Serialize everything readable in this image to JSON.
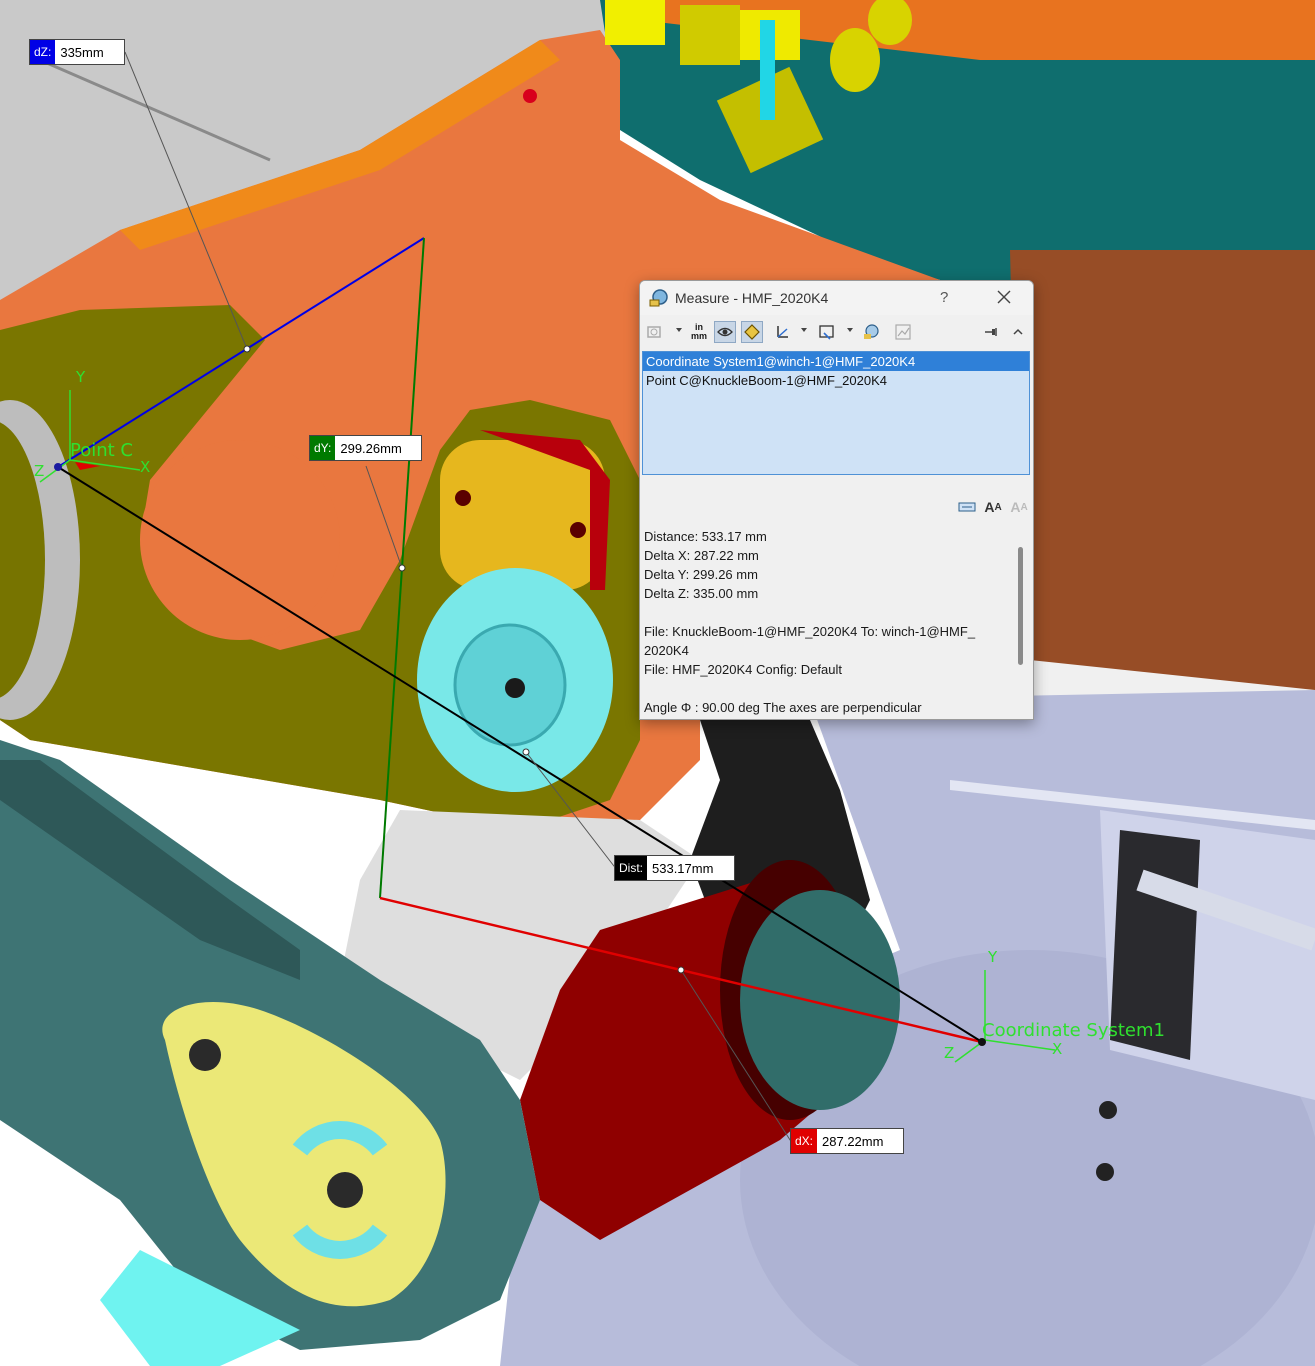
{
  "dialog": {
    "title": "Measure - HMF_2020K4",
    "help_label": "?",
    "toolbar": {
      "icons": [
        "arc-circle-icon",
        "units-precision-icon",
        "show-xyz-icon",
        "point-to-point-icon",
        "projection-icon",
        "select-coordinate-system-icon",
        "create-sensor-icon",
        "measurement-history-icon",
        "pin-icon",
        "collapse-icon"
      ],
      "units_label_top": "in",
      "units_label_bottom": "mm"
    },
    "selections": [
      "Coordinate System1@winch-1@HMF_2020K4",
      "Point C@KnuckleBoom-1@HMF_2020K4"
    ],
    "format_icons": [
      "dimension-icon",
      "font-larger-icon",
      "font-smaller-icon"
    ],
    "results": {
      "distance": "Distance: 533.17 mm",
      "delta_x": "Delta X: 287.22 mm",
      "delta_y": "Delta Y: 299.26 mm",
      "delta_z": "Delta Z: 335.00 mm",
      "file_from_to_1": "File: KnuckleBoom-1@HMF_2020K4 To: winch-1@HMF_",
      "file_from_to_2": "2020K4",
      "file_config": "File: HMF_2020K4 Config: Default",
      "angle": "Angle Φ : 90.00 deg  The axes are perpendicular"
    }
  },
  "callouts": {
    "dz": {
      "key": "dZ:",
      "value": "335mm"
    },
    "dy": {
      "key": "dY:",
      "value": "299.26mm"
    },
    "dist": {
      "key": "Dist:",
      "value": "533.17mm"
    },
    "dx": {
      "key": "dX:",
      "value": "287.22mm"
    }
  },
  "origins": {
    "point_c": "Point C",
    "coord_system": "Coordinate System1",
    "axis_x": "X",
    "axis_y": "Y",
    "axis_z": "Z"
  },
  "colors": {
    "dz": "#0000e6",
    "dy": "#007a00",
    "dist": "#000000",
    "dx": "#e00000",
    "selection": "#2f80d8",
    "triad": "#2fe02f"
  }
}
